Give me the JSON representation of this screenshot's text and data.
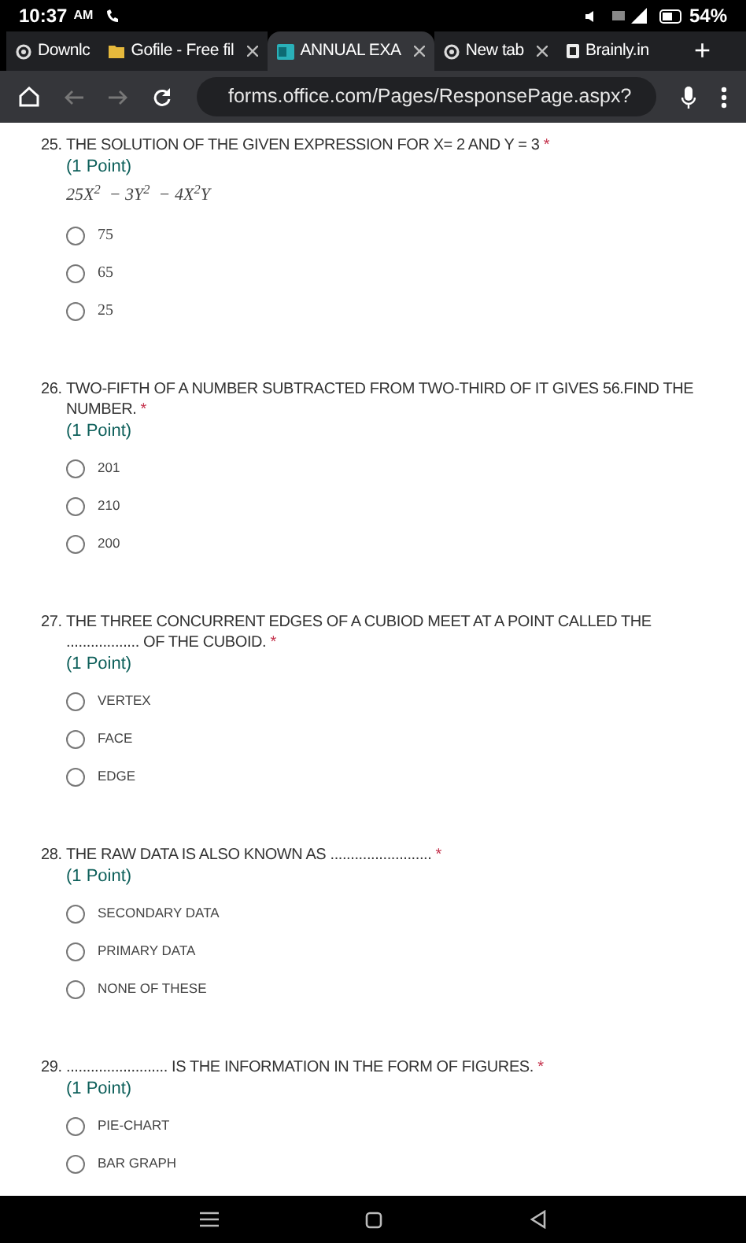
{
  "status_bar": {
    "time": "10:37",
    "ampm": "AM",
    "battery": "54%"
  },
  "tabs": [
    {
      "label": "Downlc",
      "selected": false,
      "closable": false
    },
    {
      "label": "Gofile - Free fil",
      "selected": false,
      "closable": true
    },
    {
      "label": "ANNUAL EXA",
      "selected": true,
      "closable": true
    },
    {
      "label": "New tab",
      "selected": false,
      "closable": true
    },
    {
      "label": "Brainly.in",
      "selected": false,
      "closable": false
    }
  ],
  "new_tab": "+",
  "address_bar": {
    "url": "forms.office.com/Pages/ResponsePage.aspx?"
  },
  "questions": [
    {
      "number": "25.",
      "text": "THE SOLUTION OF THE GIVEN EXPRESSION FOR X= 2 AND Y = 3",
      "required_mark": "*",
      "points": "(1 Point)",
      "expression": "25X$^{2}$  − 3Y$^{2}$  − 4X$^{2}$Y",
      "options": [
        {
          "label": "75",
          "selected": false
        },
        {
          "label": "65",
          "selected": false
        },
        {
          "label": "25",
          "selected": false
        }
      ]
    },
    {
      "number": "26.",
      "text": "TWO-FIFTH OF A NUMBER SUBTRACTED FROM TWO-THIRD OF IT GIVES 56.FIND THE NUMBER.",
      "required_mark": "*",
      "points": "(1 Point)",
      "options": [
        {
          "label": "201",
          "selected": false
        },
        {
          "label": "210",
          "selected": false
        },
        {
          "label": "200",
          "selected": false
        }
      ]
    },
    {
      "number": "27.",
      "text": "THE THREE CONCURRENT EDGES OF A CUBIOD MEET AT A POINT CALLED THE .................. OF THE CUBOID.",
      "required_mark": "*",
      "points": "(1 Point)",
      "options": [
        {
          "label": "VERTEX",
          "selected": false
        },
        {
          "label": "FACE",
          "selected": false
        },
        {
          "label": "EDGE",
          "selected": false
        }
      ]
    },
    {
      "number": "28.",
      "text": "THE RAW DATA IS ALSO KNOWN AS   .........................",
      "required_mark": "*",
      "points": "(1 Point)",
      "options": [
        {
          "label": "SECONDARY DATA",
          "selected": false
        },
        {
          "label": "PRIMARY DATA",
          "selected": false
        },
        {
          "label": "NONE OF THESE",
          "selected": false
        }
      ]
    },
    {
      "number": "29.",
      "text": "......................... IS THE INFORMATION IN THE FORM OF FIGURES.",
      "required_mark": "*",
      "points": "(1 Point)",
      "options": [
        {
          "label": "PIE-CHART",
          "selected": false
        },
        {
          "label": "BAR GRAPH",
          "selected": false
        }
      ]
    }
  ]
}
